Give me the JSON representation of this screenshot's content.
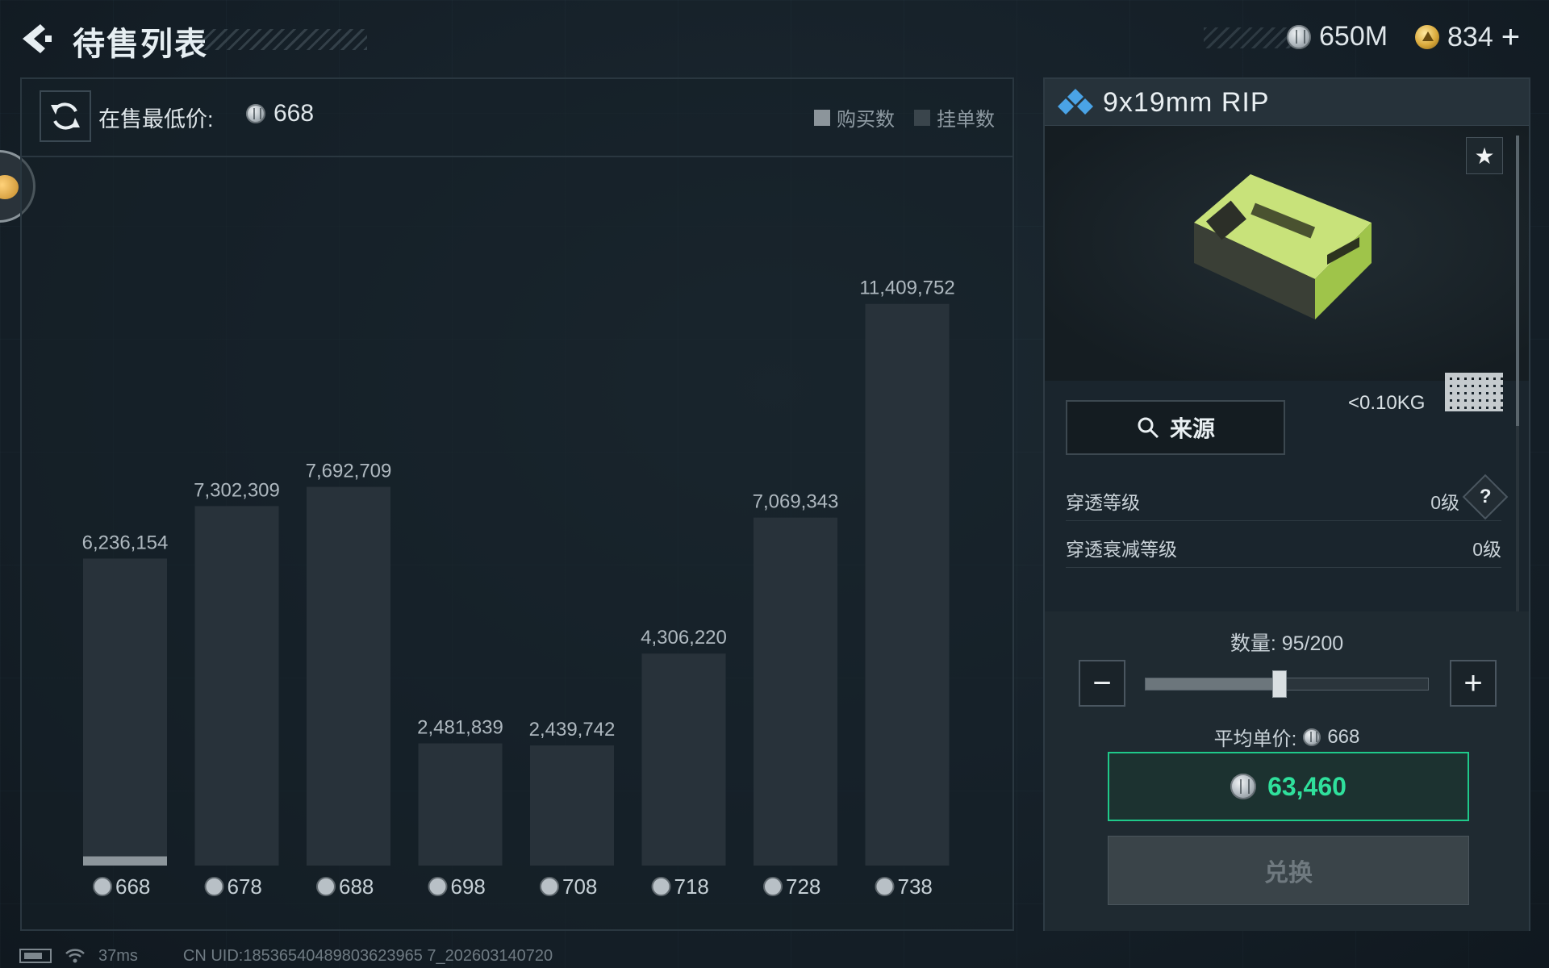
{
  "header": {
    "title": "待售列表",
    "silver_amount": "650M",
    "gold_amount": "834"
  },
  "market": {
    "lowest_label": "在售最低价:",
    "lowest_value": "668",
    "legend": [
      {
        "label": "购买数",
        "color": "#8c959b"
      },
      {
        "label": "挂单数",
        "color": "#3a454c"
      }
    ]
  },
  "chart_data": {
    "type": "bar",
    "categories": [
      "668",
      "678",
      "688",
      "698",
      "708",
      "718",
      "728",
      "738"
    ],
    "series": [
      {
        "name": "购买数",
        "values": [
          95,
          0,
          0,
          0,
          0,
          0,
          0,
          0
        ]
      },
      {
        "name": "挂单数",
        "values": [
          6236154,
          7302309,
          7692709,
          2481839,
          2439742,
          4306220,
          7069343,
          11409752
        ]
      }
    ],
    "value_labels": [
      "6,236,154",
      "7,302,309",
      "7,692,709",
      "2,481,839",
      "2,439,742",
      "4,306,220",
      "7,069,343",
      "11,409,752"
    ],
    "ylim": [
      0,
      12700000
    ],
    "grid": false,
    "legend_position": "top-right"
  },
  "item": {
    "name": "9x19mm RIP",
    "weight": "<0.10KG",
    "source_label": "来源",
    "attributes": [
      {
        "label": "穿透等级",
        "value": "0级",
        "help": "?"
      },
      {
        "label": "穿透衰减等级",
        "value": "0级"
      }
    ]
  },
  "purchase": {
    "qty_label": "数量: 95/200",
    "qty_current": 95,
    "qty_max": 200,
    "avg_label": "平均单价:",
    "avg_value": "668",
    "total": "63,460",
    "exchange_label": "兑换"
  },
  "status": {
    "ping": "37ms",
    "uid": "CN UID:18536540489803623965 7_202603140720"
  }
}
